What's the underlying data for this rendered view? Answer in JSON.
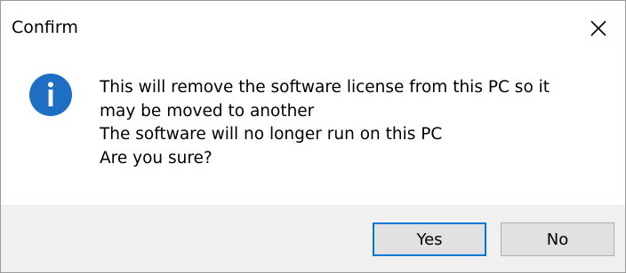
{
  "window": {
    "title": "Confirm"
  },
  "icons": {
    "info": "info-icon",
    "close": "close-icon"
  },
  "message": {
    "lines": [
      "This will remove the software license from this PC so it",
      "may be moved to another",
      "The software will no longer run on this PC",
      "Are you sure?"
    ]
  },
  "buttons": {
    "yes_label": "Yes",
    "no_label": "No"
  },
  "colors": {
    "info_icon_fill": "#1e6fc4",
    "default_button_border": "#0078d7",
    "footer_background": "#f0f0f0",
    "button_background": "#e1e1e1"
  }
}
